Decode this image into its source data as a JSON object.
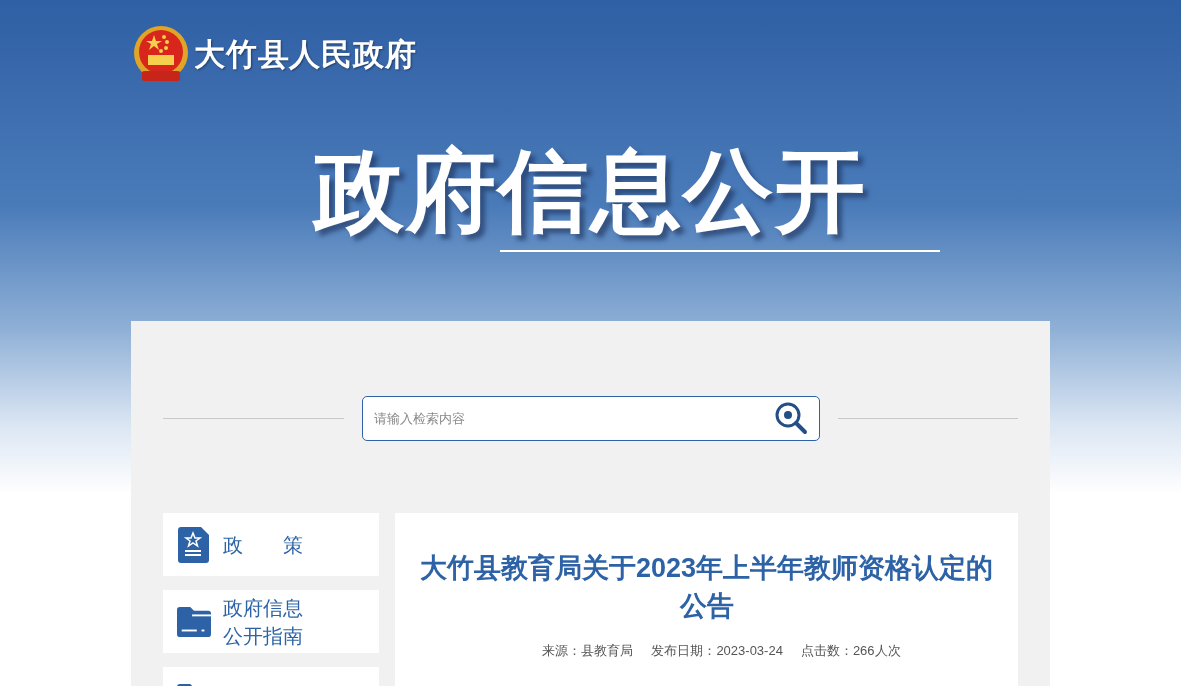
{
  "site": {
    "name": "大竹县人民政府"
  },
  "banner": {
    "title": "政府信息公开"
  },
  "search": {
    "placeholder": "请输入检索内容"
  },
  "sidebar": {
    "items": [
      {
        "label": "政　　策",
        "kind": "policy"
      },
      {
        "label": "政府信息公开指南",
        "kind": "folder"
      },
      {
        "kind": "folder"
      }
    ]
  },
  "article": {
    "title": "大竹县教育局关于2023年上半年教师资格认定的公告",
    "meta": [
      {
        "label": "来源：县教育局"
      },
      {
        "label": "发布日期：2023-03-24"
      },
      {
        "label": "点击数：266人次"
      }
    ]
  }
}
